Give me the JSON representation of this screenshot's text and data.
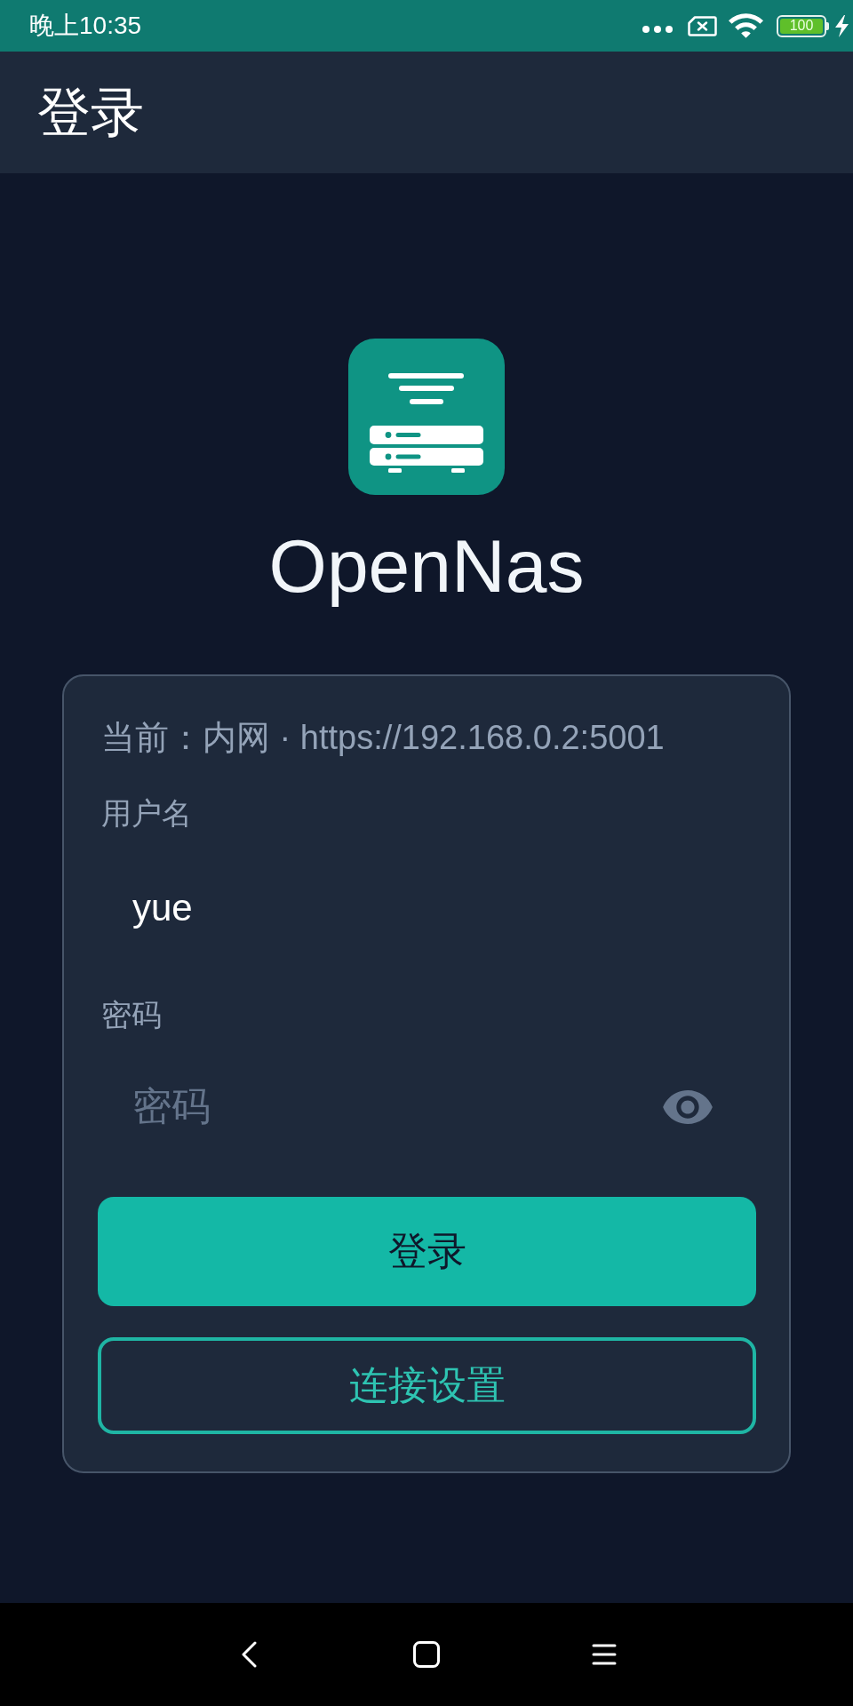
{
  "status_bar": {
    "time": "晚上10:35",
    "battery": "100"
  },
  "app_bar": {
    "title": "登录"
  },
  "brand": {
    "name": "OpenNas"
  },
  "login_card": {
    "connection": "当前：内网 · https://192.168.0.2:5001",
    "fields": [
      {
        "kind": "text",
        "label": "用户名",
        "value": "yue"
      },
      {
        "kind": "password",
        "label": "密码",
        "placeholder": "密码"
      }
    ],
    "buttons": [
      {
        "kind": "primary",
        "label": "登录"
      },
      {
        "kind": "outline",
        "label": "连接设置"
      }
    ]
  }
}
